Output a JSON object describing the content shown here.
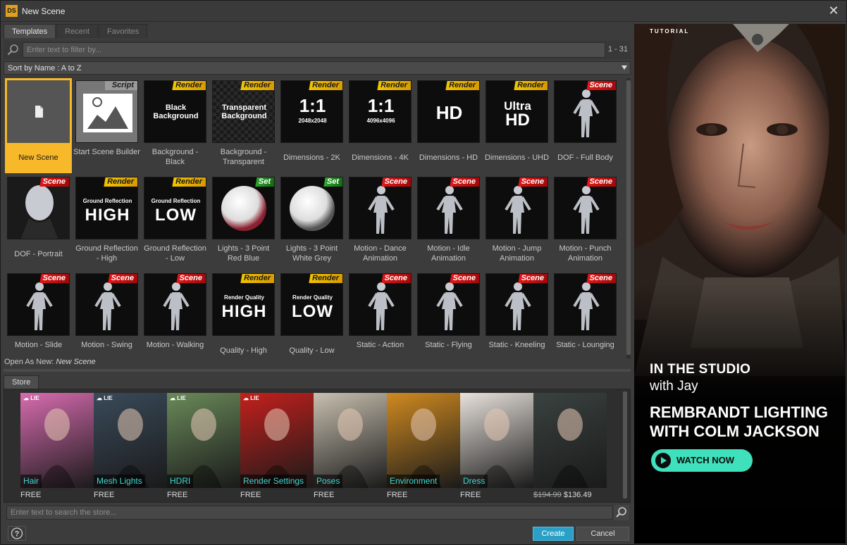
{
  "window": {
    "title": "New Scene",
    "logo_text": "DS"
  },
  "tabs": [
    "Templates",
    "Recent",
    "Favorites"
  ],
  "filter": {
    "placeholder": "Enter text to filter by...",
    "count": "1 - 31"
  },
  "sort": {
    "label": "Sort by Name : A to Z"
  },
  "templates": [
    {
      "label": "New Scene",
      "badge": "",
      "thumb": "new-scene-icon"
    },
    {
      "label": "Start Scene Builder",
      "badge": "Script",
      "thumb": "scene-builder-icon"
    },
    {
      "label": "Background - Black",
      "badge": "Render",
      "thumb_text": "Black Background"
    },
    {
      "label": "Background - Transparent",
      "badge": "Render",
      "thumb_text": "Transparent Background"
    },
    {
      "label": "Dimensions - 2K",
      "badge": "Render",
      "thumb_text": "1:1",
      "thumb_sub": "2048x2048"
    },
    {
      "label": "Dimensions - 4K",
      "badge": "Render",
      "thumb_text": "1:1",
      "thumb_sub": "4096x4096"
    },
    {
      "label": "Dimensions - HD",
      "badge": "Render",
      "thumb_text": "HD"
    },
    {
      "label": "Dimensions - UHD",
      "badge": "Render",
      "thumb_text": "Ultra",
      "thumb_sub": "HD"
    },
    {
      "label": "DOF - Full Body",
      "badge": "Scene",
      "thumb": "figure-icon"
    },
    {
      "label": "DOF - Portrait",
      "badge": "Scene",
      "thumb": "portrait-icon"
    },
    {
      "label": "Ground Reflection - High",
      "badge": "Render",
      "thumb_text": "Ground Reflection",
      "thumb_sub": "HIGH"
    },
    {
      "label": "Ground Reflection - Low",
      "badge": "Render",
      "thumb_text": "Ground Reflection",
      "thumb_sub": "LOW"
    },
    {
      "label": "Lights - 3 Point Red Blue",
      "badge": "Set",
      "thumb": "sphere-red-blue-icon"
    },
    {
      "label": "Lights - 3 Point White Grey",
      "badge": "Set",
      "thumb": "sphere-grey-icon"
    },
    {
      "label": "Motion - Dance Animation",
      "badge": "Scene",
      "thumb": "figure-icon"
    },
    {
      "label": "Motion - Idle Animation",
      "badge": "Scene",
      "thumb": "figure-icon"
    },
    {
      "label": "Motion - Jump Animation",
      "badge": "Scene",
      "thumb": "figure-icon"
    },
    {
      "label": "Motion - Punch Animation",
      "badge": "Scene",
      "thumb": "figure-icon"
    },
    {
      "label": "Motion - Slide",
      "badge": "Scene",
      "thumb": "figure-icon"
    },
    {
      "label": "Motion - Swing",
      "badge": "Scene",
      "thumb": "figure-icon"
    },
    {
      "label": "Motion - Walking",
      "badge": "Scene",
      "thumb": "figure-icon"
    },
    {
      "label": "Quality - High",
      "badge": "Render",
      "thumb_text": "Render Quality",
      "thumb_sub": "HIGH"
    },
    {
      "label": "Quality - Low",
      "badge": "Render",
      "thumb_text": "Render Quality",
      "thumb_sub": "LOW"
    },
    {
      "label": "Static - Action",
      "badge": "Scene",
      "thumb": "figure-icon"
    },
    {
      "label": "Static - Flying",
      "badge": "Scene",
      "thumb": "figure-icon"
    },
    {
      "label": "Static - Kneeling",
      "badge": "Scene",
      "thumb": "figure-icon"
    },
    {
      "label": "Static - Lounging",
      "badge": "Scene",
      "thumb": "figure-icon"
    }
  ],
  "open_as": {
    "prefix": "Open As New:",
    "value": "New Scene"
  },
  "store": {
    "tab": "Store",
    "items": [
      {
        "category": "Hair",
        "price": "FREE",
        "color": "#d86cb0"
      },
      {
        "category": "Mesh Lights",
        "price": "FREE",
        "color": "#3a4a5a"
      },
      {
        "category": "HDRI",
        "price": "FREE",
        "color": "#6a8a5a"
      },
      {
        "category": "Render Settings",
        "price": "FREE",
        "color": "#c4201c"
      },
      {
        "category": "Poses",
        "price": "FREE",
        "color": "#c8c0b0"
      },
      {
        "category": "Environment",
        "price": "FREE",
        "color": "#d08a20"
      },
      {
        "category": "Dress",
        "price": "FREE",
        "color": "#e8e2dc"
      },
      {
        "category": "",
        "price_old": "$194.99",
        "price": "$136.49",
        "color": "#3a4240"
      }
    ],
    "search_placeholder": "Enter text to search the store..."
  },
  "buttons": {
    "create": "Create",
    "cancel": "Cancel"
  },
  "ad": {
    "tag": "TUTORIAL",
    "line1": "IN THE STUDIO",
    "line2": "with Jay",
    "headline": "REMBRANDT LIGHTING WITH COLM JACKSON",
    "cta": "WATCH NOW"
  }
}
